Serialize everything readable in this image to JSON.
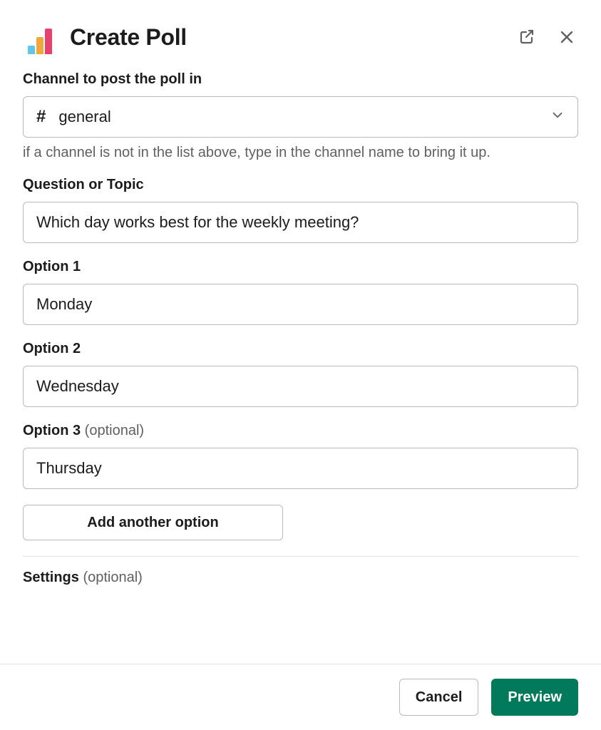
{
  "header": {
    "title": "Create Poll"
  },
  "channel": {
    "label": "Channel to post the poll in",
    "prefix": "#",
    "value": "general",
    "hint": "if a channel is not in the list above, type in the channel name to bring it up."
  },
  "question": {
    "label": "Question or Topic",
    "value": "Which day works best for the weekly meeting?"
  },
  "options": [
    {
      "label": "Option 1",
      "label_suffix": "",
      "value": "Monday"
    },
    {
      "label": "Option 2",
      "label_suffix": "",
      "value": "Wednesday"
    },
    {
      "label": "Option 3 ",
      "label_suffix": "(optional)",
      "value": "Thursday"
    }
  ],
  "add_option": "Add another option",
  "settings": {
    "label": "Settings ",
    "label_suffix": "(optional)"
  },
  "footer": {
    "cancel": "Cancel",
    "preview": "Preview"
  }
}
